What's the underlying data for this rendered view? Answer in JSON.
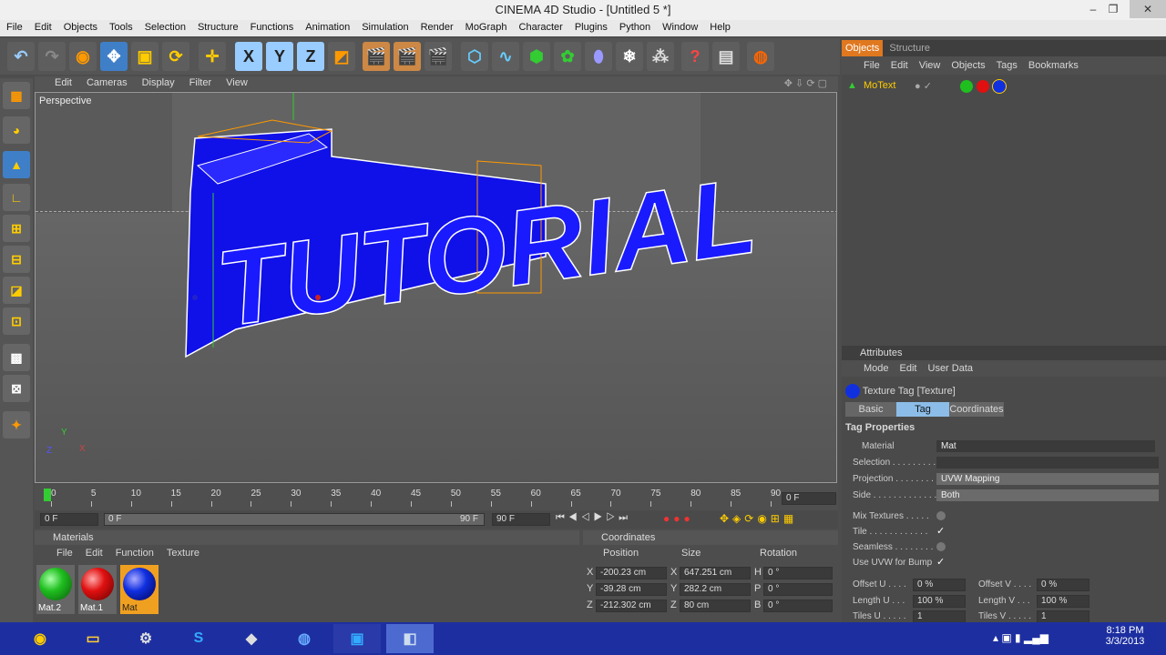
{
  "window": {
    "title": "CINEMA 4D Studio - [Untitled 5 *]",
    "minimize": "–",
    "maximize": "❐",
    "close": "✕"
  },
  "menu": [
    "File",
    "Edit",
    "Objects",
    "Tools",
    "Selection",
    "Structure",
    "Functions",
    "Animation",
    "Simulation",
    "Render",
    "MoGraph",
    "Character",
    "Plugins",
    "Python",
    "Window",
    "Help"
  ],
  "toolbar": {
    "x_label": "X",
    "y_label": "Y",
    "z_label": "Z"
  },
  "viewport": {
    "menu": [
      "Edit",
      "Cameras",
      "Display",
      "Filter",
      "View"
    ],
    "label": "Perspective",
    "text3d": "TUTORIAL",
    "axis": {
      "x": "X",
      "y": "Y",
      "z": "Z"
    }
  },
  "timeline": {
    "ticks": [
      "0",
      "5",
      "10",
      "15",
      "20",
      "25",
      "30",
      "35",
      "40",
      "45",
      "50",
      "55",
      "60",
      "65",
      "70",
      "75",
      "80",
      "85",
      "90"
    ],
    "current": "0 F",
    "start": "0 F",
    "range_start": "0 F",
    "range_end": "90 F",
    "end": "90 F"
  },
  "materials": {
    "title": "Materials",
    "menu": [
      "File",
      "Edit",
      "Function",
      "Texture"
    ],
    "items": [
      {
        "name": "Mat.2",
        "color": "#1fbf1f"
      },
      {
        "name": "Mat.1",
        "color": "#e01010"
      },
      {
        "name": "Mat",
        "color": "#1030e0"
      }
    ]
  },
  "coordinates": {
    "title": "Coordinates",
    "headers": [
      "Position",
      "Size",
      "Rotation"
    ],
    "rows": [
      {
        "axis": "X",
        "pos": "-200.23 cm",
        "size_axis": "X",
        "size": "647.251 cm",
        "rot_axis": "H",
        "rot": "0 °"
      },
      {
        "axis": "Y",
        "pos": "-39.28 cm",
        "size_axis": "Y",
        "size": "282.2 cm",
        "rot_axis": "P",
        "rot": "0 °"
      },
      {
        "axis": "Z",
        "pos": "-212.302 cm",
        "size_axis": "Z",
        "size": "80 cm",
        "rot_axis": "B",
        "rot": "0 °"
      }
    ]
  },
  "objects_panel": {
    "tabs": [
      "Objects",
      "Structure"
    ],
    "menu": [
      "File",
      "Edit",
      "View",
      "Objects",
      "Tags",
      "Bookmarks"
    ],
    "object_name": "MoText"
  },
  "attributes": {
    "title": "Attributes",
    "menu": [
      "Mode",
      "Edit",
      "User Data"
    ],
    "tag_title": "Texture Tag [Texture]",
    "tabs": [
      "Basic",
      "Tag",
      "Coordinates"
    ],
    "section": "Tag Properties",
    "material_label": "Material",
    "material_value": "Mat",
    "selection_label": "Selection . . . . . . . . .",
    "projection_label": "Projection . . . . . . . .",
    "projection_value": "UVW Mapping",
    "side_label": "Side . . . . . . . . . . . . .",
    "side_value": "Both",
    "mix_label": "Mix Textures . . . . .",
    "tile_label": "Tile . . . . . . . . . . . .",
    "seamless_label": "Seamless . . . . . . . .",
    "uvwbump_label": "Use UVW for Bump",
    "offset_u_label": "Offset U . . . .",
    "offset_u": "0 %",
    "offset_v_label": "Offset V . . . .",
    "offset_v": "0 %",
    "length_u_label": "Length U . . .",
    "length_u": "100 %",
    "length_v_label": "Length V . . .",
    "length_v": "100 %",
    "tiles_u_label": "Tiles U . . . . .",
    "tiles_u": "1",
    "tiles_v_label": "Tiles V . . . . .",
    "tiles_v": "1"
  },
  "taskbar": {
    "time": "8:18 PM",
    "date": "3/3/2013"
  }
}
